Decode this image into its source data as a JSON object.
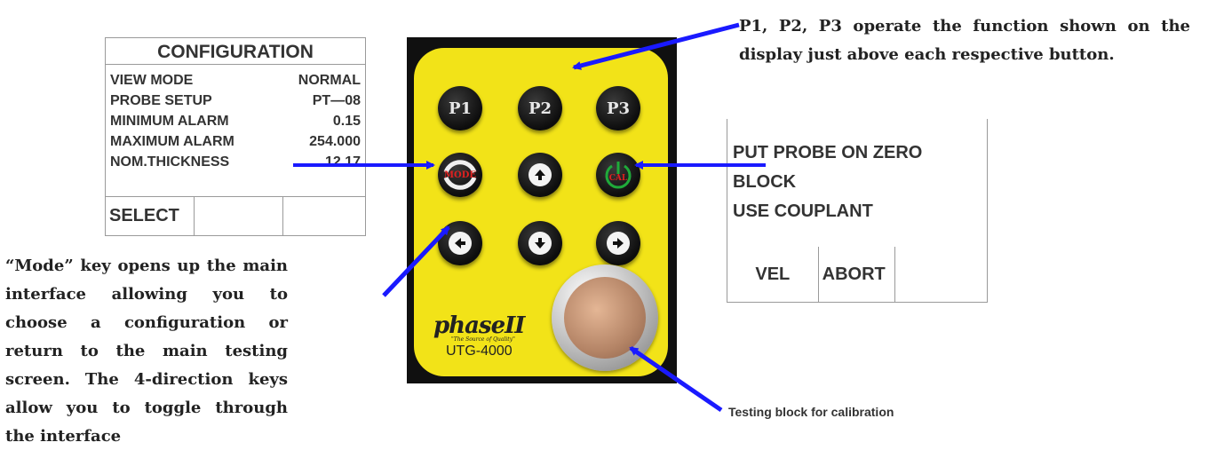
{
  "config_screen": {
    "title": "CONFIGURATION",
    "rows": [
      {
        "label": "VIEW MODE",
        "value": "NORMAL"
      },
      {
        "label": "PROBE SETUP",
        "value": "PT—08"
      },
      {
        "label": "MINIMUM ALARM",
        "value": "0.15"
      },
      {
        "label": "MAXIMUM ALARM",
        "value": "254.000"
      },
      {
        "label": "NOM.THICKNESS",
        "value": "12.17"
      }
    ],
    "softkeys": [
      "SELECT",
      "",
      ""
    ]
  },
  "zero_screen": {
    "lines": [
      "PUT PROBE ON ZERO",
      "BLOCK",
      "USE COUPLANT"
    ],
    "softkeys": [
      "VEL",
      "ABORT",
      ""
    ]
  },
  "keypad": {
    "keys": {
      "p1": "P1",
      "p2": "P2",
      "p3": "P3",
      "mode": "MODE",
      "cal": "CAL"
    },
    "brand": "phaseII",
    "tagline": "\"The Source of Quality\"",
    "model": "UTG-4000",
    "colors": {
      "face": "#f2e318",
      "key": "#111111",
      "accent": "#e02020",
      "cal_ring": "#1faa3a"
    }
  },
  "annotations": {
    "top_note": "P1, P2, P3 operate the function shown on the display just above each respective button.",
    "left_note": "“Mode” key opens up the main interface allowing you to choose a configuration or return to the main testing screen. The 4-direction keys allow you to toggle through the interface",
    "sensor_caption": "Testing block for calibration",
    "arrow_color": "#1a1aff"
  },
  "icons": [
    "up-arrow-icon",
    "down-arrow-icon",
    "left-arrow-icon",
    "right-arrow-icon",
    "power-icon"
  ]
}
